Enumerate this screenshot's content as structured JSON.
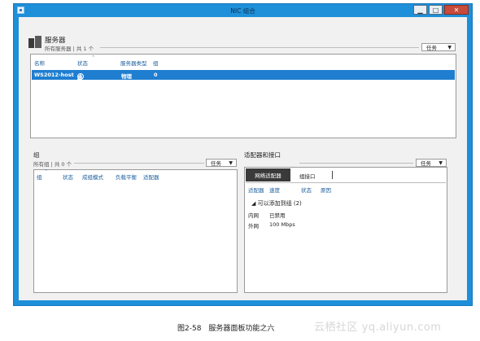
{
  "window": {
    "title": "NIC 组合",
    "minimize": "▁",
    "maximize": "□",
    "close": "✕"
  },
  "servers": {
    "heading": "服务器",
    "subheading": "所有服务器 | 共 1 个",
    "tasks_label": "任务",
    "columns": [
      "名称",
      "状态",
      "服务器类型",
      "组"
    ],
    "rows": [
      {
        "name": "WS2012-host",
        "status": "联机",
        "type": "物理",
        "group": "0"
      }
    ]
  },
  "groups": {
    "heading": "组",
    "subheading": "所有组 | 共 0 个",
    "tasks_label": "任务",
    "columns": [
      "组",
      "状态",
      "成组模式",
      "负载平衡",
      "适配器"
    ]
  },
  "adapters": {
    "heading": "适配器和接口",
    "tasks_label": "任务",
    "tabs": [
      "网络适配器",
      "组接口"
    ],
    "columns": [
      "适配器",
      "速度",
      "状态",
      "原因"
    ],
    "group_label": "可以添加到组 (2)",
    "rows": [
      {
        "name": "内网",
        "value": "已禁用"
      },
      {
        "name": "外网",
        "value": "100 Mbps"
      }
    ]
  },
  "caption": "图2-58　服务器面板功能之六",
  "watermark": "云栖社区 yq.aliyun.com",
  "colors": {
    "frame": "#1e8fd9",
    "selection": "#1f7ed0",
    "active_tab": "#3a3a3a"
  }
}
